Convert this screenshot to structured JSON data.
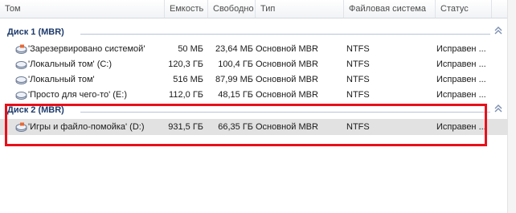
{
  "columns": {
    "volume": "Том",
    "capacity": "Емкость",
    "free": "Свободно",
    "type": "Тип",
    "fs": "Файловая система",
    "status": "Статус"
  },
  "groups": [
    {
      "label": "Диск 1 (MBR)",
      "rows": [
        {
          "name": "'Зарезервировано системой'",
          "capacity": "50 МБ",
          "free": "23,64 МБ",
          "type": "Основной MBR",
          "fs": "NTFS",
          "status": "Исправен ..."
        },
        {
          "name": "'Локальный том' (C:)",
          "capacity": "120,3 ГБ",
          "free": "100,4 ГБ",
          "type": "Основной MBR",
          "fs": "NTFS",
          "status": "Исправен ..."
        },
        {
          "name": "'Локальный том'",
          "capacity": "516 МБ",
          "free": "87,99 МБ",
          "type": "Основной MBR",
          "fs": "NTFS",
          "status": "Исправен ..."
        },
        {
          "name": "'Просто для чего-то' (E:)",
          "capacity": "112,0 ГБ",
          "free": "48,15 ГБ",
          "type": "Основной MBR",
          "fs": "NTFS",
          "status": "Исправен ..."
        }
      ]
    },
    {
      "label": "Диск 2 (MBR)",
      "rows": [
        {
          "name": "'Игры и файло-помойка' (D:)",
          "capacity": "931,5 ГБ",
          "free": "66,35 ГБ",
          "type": "Основной MBR",
          "fs": "NTFS",
          "status": "Исправен ..."
        }
      ]
    }
  ],
  "colors": {
    "selected_row": "#e2e2e2",
    "group_text": "#1e3b6b",
    "highlight_box": "#e8101a"
  },
  "icons": {
    "collapse": "chevron-double-up-icon",
    "disk": "disk-volume-icon"
  }
}
